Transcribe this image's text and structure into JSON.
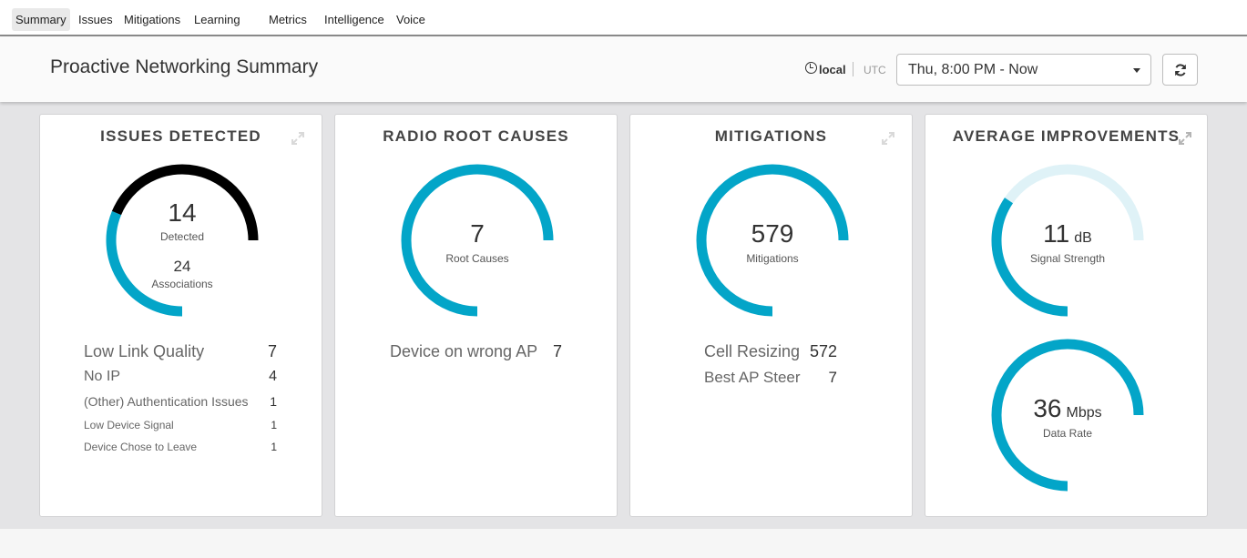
{
  "nav": {
    "tabs": [
      {
        "label": "Summary",
        "active": true
      },
      {
        "label": "Issues"
      },
      {
        "label": "Mitigations"
      },
      {
        "label": "Learning"
      },
      {
        "label": "Metrics"
      },
      {
        "label": "Intelligence"
      },
      {
        "label": "Voice"
      }
    ]
  },
  "header": {
    "title": "Proactive Networking Summary",
    "timezone_local": "local",
    "timezone_utc": "UTC",
    "time_range": "Thu, 8:00 PM - Now"
  },
  "colors": {
    "primary": "#03a5c8",
    "dark": "#000000",
    "light": "#dff2f7"
  },
  "cards": {
    "issues": {
      "title": "ISSUES DETECTED",
      "detected": "14",
      "detected_label": "Detected",
      "associations": "24",
      "associations_label": "Associations",
      "gauge": {
        "detected_fraction": 0.583
      },
      "items": [
        {
          "label": "Low Link Quality",
          "value": "7"
        },
        {
          "label": "No IP",
          "value": "4"
        },
        {
          "label": "(Other) Authentication Issues",
          "value": "1"
        },
        {
          "label": "Low Device Signal",
          "value": "1"
        },
        {
          "label": "Device Chose to Leave",
          "value": "1"
        }
      ]
    },
    "radio": {
      "title": "RADIO ROOT CAUSES",
      "value": "7",
      "label": "Root Causes",
      "items": [
        {
          "label": "Device on wrong AP",
          "value": "7"
        }
      ]
    },
    "mitigations": {
      "title": "MITIGATIONS",
      "value": "579",
      "label": "Mitigations",
      "items": [
        {
          "label": "Cell Resizing",
          "value": "572"
        },
        {
          "label": "Best AP Steer",
          "value": "7"
        }
      ]
    },
    "improvements": {
      "title": "AVERAGE IMPROVEMENTS",
      "signal": {
        "value": "11",
        "unit": "dB",
        "label": "Signal Strength",
        "fill_fraction": 0.46
      },
      "rate": {
        "value": "36",
        "unit": "Mbps",
        "label": "Data Rate",
        "fill_fraction": 1.0
      }
    }
  }
}
